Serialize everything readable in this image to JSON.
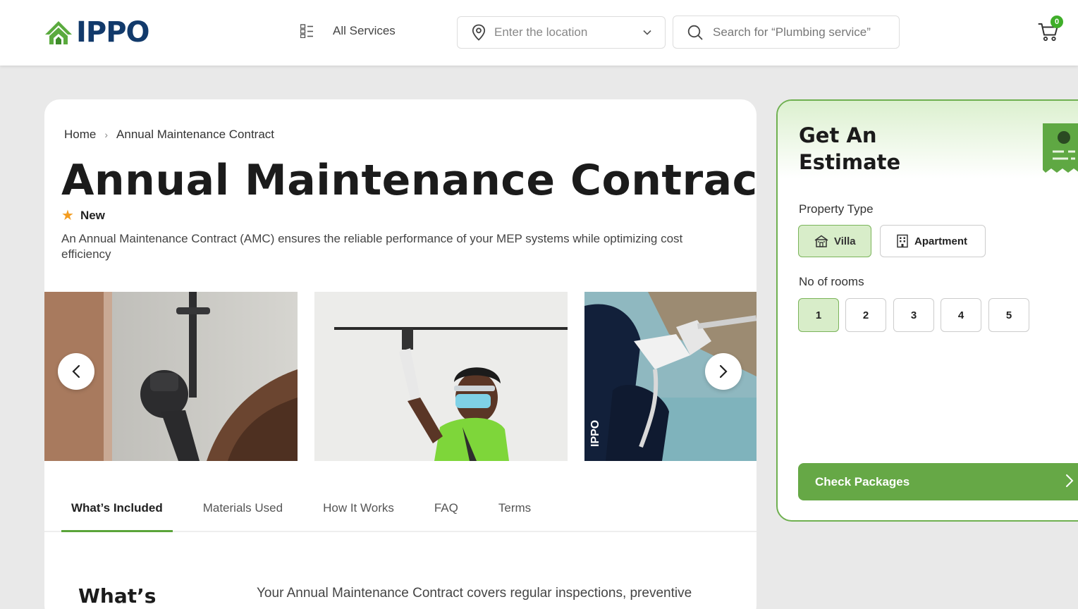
{
  "brand": {
    "name": "IPPO",
    "primary": "#123a6b",
    "accent": "#66a846",
    "cart_count": "0"
  },
  "header": {
    "all_services": "All Services",
    "location_placeholder": "Enter the location",
    "search_placeholder": "Search for “Plumbing service”"
  },
  "breadcrumb": {
    "home": "Home",
    "current": "Annual Maintenance Contract"
  },
  "service": {
    "title": "Annual Maintenance Contract",
    "badge": "New",
    "description": "An Annual Maintenance Contract (AMC) ensures the reliable performance of your MEP systems while optimizing cost efficiency"
  },
  "gallery": {
    "images": [
      "bathroom-faucet-photo",
      "technician-ceiling-photo",
      "technician-cleaning-photo"
    ]
  },
  "tabs": [
    {
      "label": "What’s Included",
      "active": true
    },
    {
      "label": "Materials Used"
    },
    {
      "label": "How It Works"
    },
    {
      "label": "FAQ"
    },
    {
      "label": "Terms"
    }
  ],
  "content": {
    "heading": "What’s",
    "text": "Your Annual Maintenance Contract covers regular inspections, preventive"
  },
  "estimate": {
    "title": "Get An Estimate",
    "property_type_label": "Property Type",
    "property_types": [
      {
        "label": "Villa",
        "selected": true
      },
      {
        "label": "Apartment"
      }
    ],
    "rooms_label": "No of rooms",
    "rooms": [
      "1",
      "2",
      "3",
      "4",
      "5"
    ],
    "selected_room": "1",
    "cta": "Check Packages"
  }
}
